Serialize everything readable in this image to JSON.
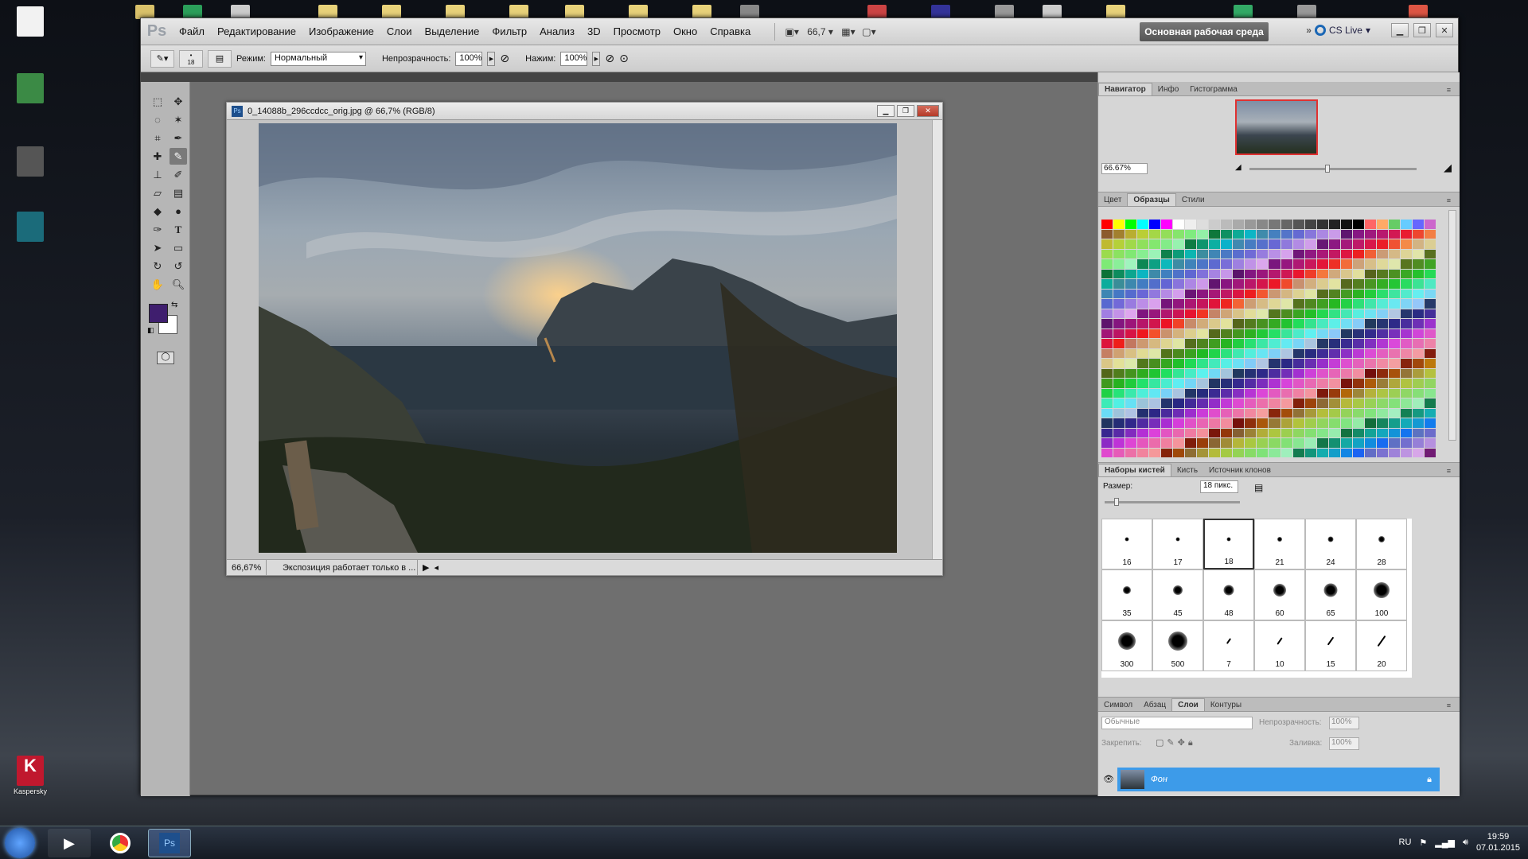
{
  "desktop": {
    "icons": [
      {
        "label": ""
      },
      {
        "label": ""
      },
      {
        "label": ""
      },
      {
        "label": ""
      },
      {
        "label": "Kaspersky"
      }
    ]
  },
  "app": {
    "logo": "Ps",
    "menu": [
      "Файл",
      "Редактирование",
      "Изображение",
      "Слои",
      "Выделение",
      "Фильтр",
      "Анализ",
      "3D",
      "Просмотр",
      "Окно",
      "Справка"
    ],
    "zoom": "66,7",
    "workspace_label": "Основная рабочая среда",
    "cslive_label": "CS Live"
  },
  "options": {
    "brush_size": "18",
    "mode_label": "Режим:",
    "mode_value": "Нормальный",
    "opacity_label": "Непрозрачность:",
    "opacity_value": "100%",
    "flow_label": "Нажим:",
    "flow_value": "100%"
  },
  "document": {
    "title": "0_14088b_296ccdcc_orig.jpg @ 66,7% (RGB/8)",
    "status_zoom": "66,67%",
    "status_text": "Экспозиция работает только в ..."
  },
  "panels": {
    "nav_tabs": [
      "Навигатор",
      "Инфо",
      "Гистограмма"
    ],
    "nav_zoom": "66.67%",
    "swatch_tabs": [
      "Цвет",
      "Образцы",
      "Стили"
    ],
    "brush_tabs": [
      "Наборы кистей",
      "Кисть",
      "Источник клонов"
    ],
    "brush_size_label": "Размер:",
    "brush_size_value": "18 пикс.",
    "brushes": [
      "16",
      "17",
      "18",
      "21",
      "24",
      "28",
      "35",
      "45",
      "48",
      "60",
      "65",
      "100",
      "300",
      "500",
      "7",
      "10",
      "15",
      "20"
    ],
    "layer_tabs": [
      "Символ",
      "Абзац",
      "Слои",
      "Контуры"
    ],
    "blend_mode": "Обычные",
    "opacity_label": "Непрозрачность:",
    "opacity_value": "100%",
    "lock_label": "Закрепить:",
    "fill_label": "Заливка:",
    "fill_value": "100%",
    "layer_name": "Фон"
  },
  "taskbar": {
    "lang": "RU",
    "time": "19:59",
    "date": "07.01.2015"
  },
  "colors": {
    "foreground": "#3f1e6e",
    "layer_selected": "#3d9be9"
  }
}
